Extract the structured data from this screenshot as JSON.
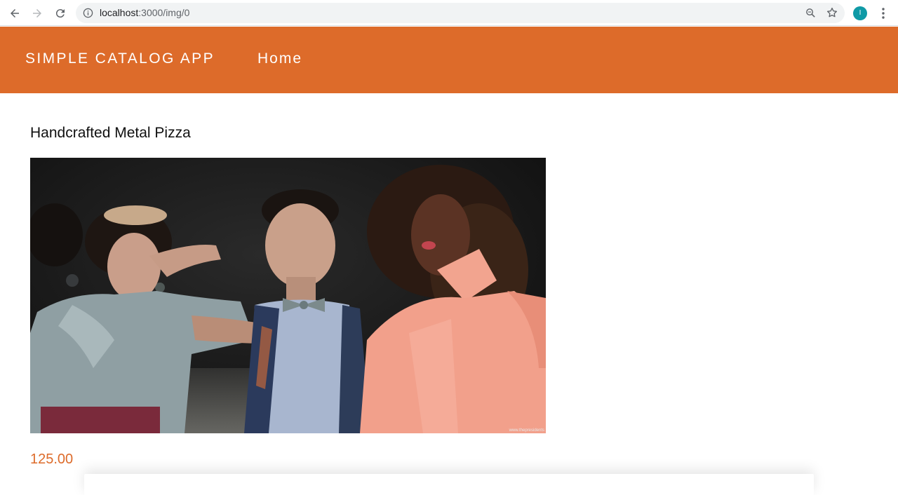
{
  "browser": {
    "url_host": "localhost",
    "url_path": ":3000/img/0",
    "profile_initial": "I"
  },
  "header": {
    "app_title": "SIMPLE CATALOG APP",
    "nav_home": "Home",
    "color": "#dd6b2a"
  },
  "product": {
    "title": "Handcrafted Metal Pizza",
    "price": "125.00",
    "image_watermark": "www.thepresidents"
  },
  "icons": {
    "back": "arrow-left-icon",
    "forward": "arrow-right-icon",
    "reload": "reload-icon",
    "info": "info-icon",
    "zoom": "zoom-icon",
    "bookmark": "star-icon",
    "menu": "kebab-menu-icon"
  }
}
